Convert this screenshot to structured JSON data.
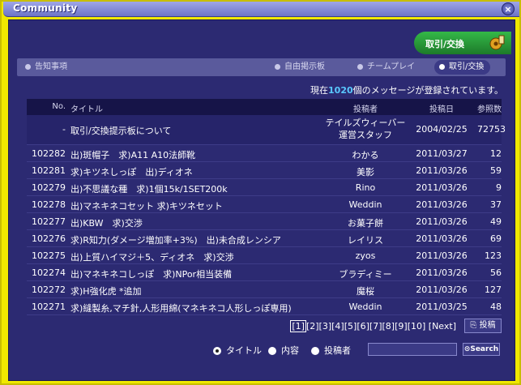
{
  "window": {
    "title": "Community",
    "close_label": "×"
  },
  "badge": {
    "label": "取引/交換"
  },
  "tabs": [
    {
      "label": "告知事項",
      "active": false
    },
    {
      "label": "自由掲示板",
      "active": false
    },
    {
      "label": "チームプレイ",
      "active": false
    },
    {
      "label": "取引/交換",
      "active": true
    }
  ],
  "count": {
    "prefix": "現在",
    "number": "1020",
    "suffix": "個のメッセージが登録されています。"
  },
  "table": {
    "headers": {
      "no": "No.",
      "title": "タイトル",
      "author": "投稿者",
      "date": "投稿日",
      "views": "参照数"
    },
    "pinned": {
      "no": "-",
      "title": "取引/交換提示板について",
      "author_line1": "テイルズウィーバー",
      "author_line2": "運営スタッフ",
      "date": "2004/02/25",
      "views": "72753"
    },
    "rows": [
      {
        "no": "102282",
        "title": "出)斑帽子　求)A11 A10法師靴",
        "author": "わかる",
        "date": "2011/03/27",
        "views": "12"
      },
      {
        "no": "102281",
        "title": "求)キツネしっぽ　出)ディオネ",
        "author": "美影",
        "date": "2011/03/26",
        "views": "59"
      },
      {
        "no": "102279",
        "title": "出)不思議な種　求)1個15k/1SET200k",
        "author": "Rino",
        "date": "2011/03/26",
        "views": "9"
      },
      {
        "no": "102278",
        "title": "出)マネキネコセット 求)キツネセット",
        "author": "Weddin",
        "date": "2011/03/26",
        "views": "37"
      },
      {
        "no": "102277",
        "title": "出)KBW　求)交渉",
        "author": "お菓子餅",
        "date": "2011/03/26",
        "views": "49"
      },
      {
        "no": "102276",
        "title": "求)R知力(ダメージ増加率+3%)　出)未合成レンシア",
        "author": "レイリス",
        "date": "2011/03/26",
        "views": "69"
      },
      {
        "no": "102275",
        "title": "出)上質ハイマジ＋5、ディオネ　求)交渉",
        "author": "zyos",
        "date": "2011/03/26",
        "views": "123"
      },
      {
        "no": "102274",
        "title": "出)マネキネコしっぽ　求)NPor相当装備",
        "author": "ブラディミー",
        "date": "2011/03/26",
        "views": "56"
      },
      {
        "no": "102272",
        "title": "求)H強化虎 *追加",
        "author": "魔桜",
        "date": "2011/03/26",
        "views": "127"
      },
      {
        "no": "102271",
        "title": "求)縫製糸,マチ針,人形用綿(マネキネコ人形しっぽ専用)",
        "author": "Weddin",
        "date": "2011/03/25",
        "views": "48"
      }
    ]
  },
  "pager": {
    "pages": [
      "[1]",
      "[2]",
      "[3]",
      "[4]",
      "[5]",
      "[6]",
      "[7]",
      "[8]",
      "[9]",
      "[10]"
    ],
    "next": "[Next]",
    "post_label": "投稿"
  },
  "search": {
    "opt_title": "タイトル",
    "opt_content": "内容",
    "opt_author": "投稿者",
    "button": "Search"
  },
  "colors": {
    "frame": "#2c2a72",
    "border": "#f0e800",
    "count_highlight": "#59c8ff"
  }
}
